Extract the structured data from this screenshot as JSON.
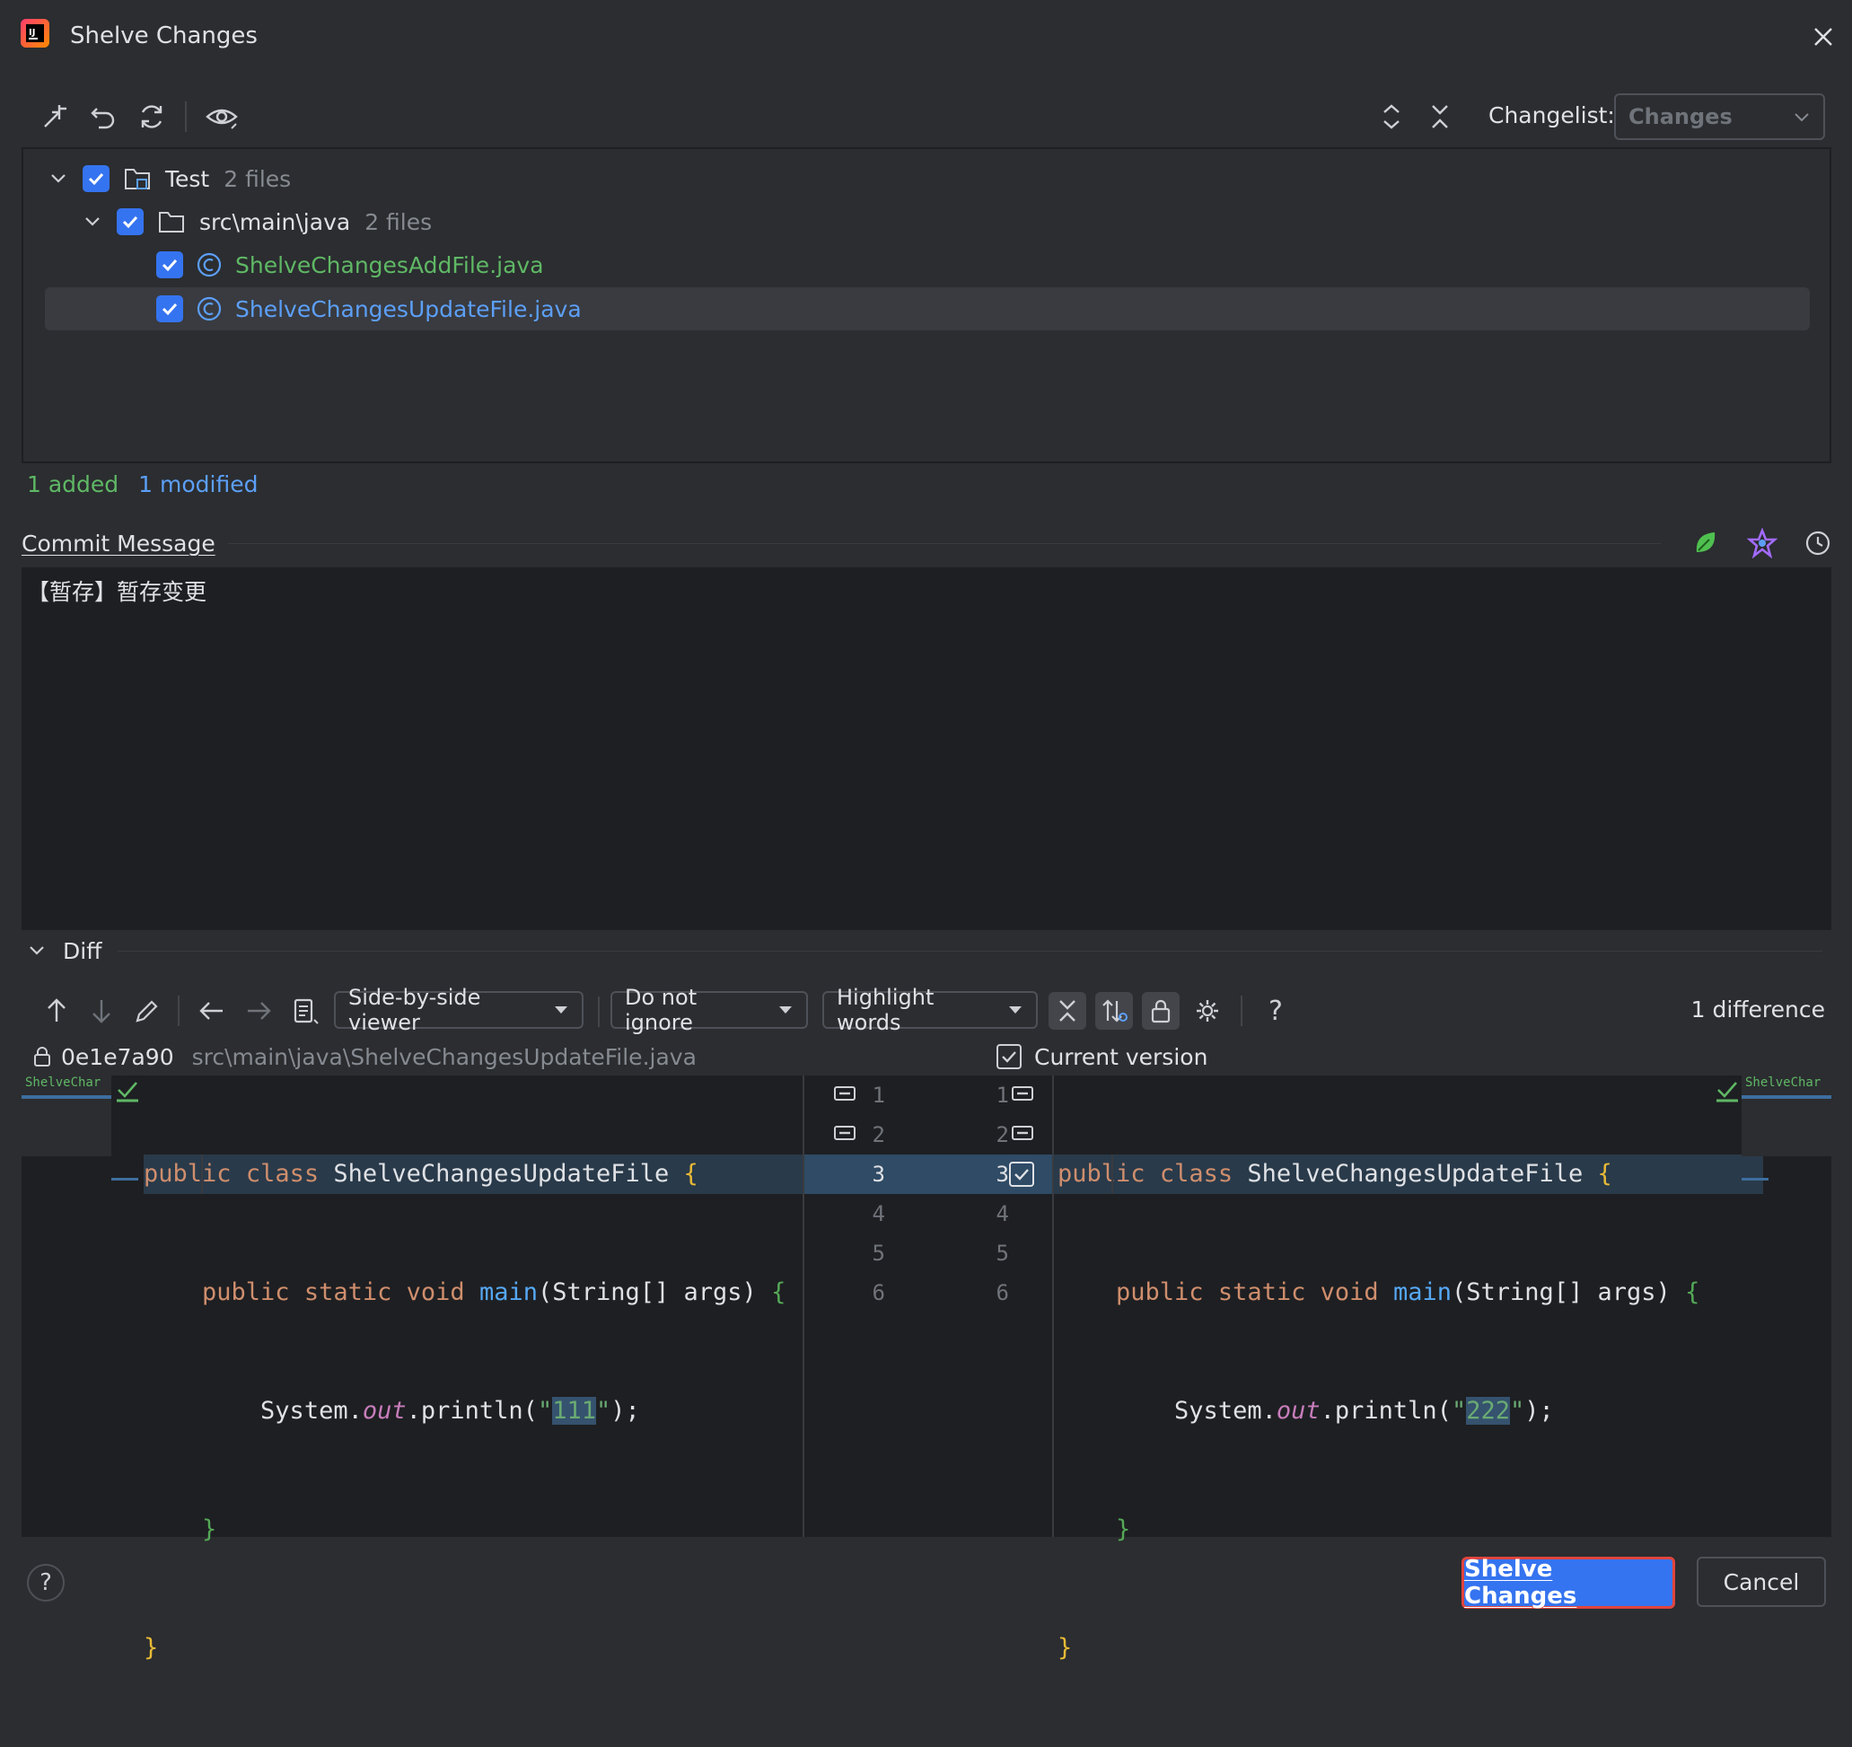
{
  "window": {
    "title": "Shelve Changes"
  },
  "toolbar": {
    "changelist_label": "Changelist:",
    "changelist_value": "Changes"
  },
  "tree": {
    "root": {
      "name": "Test",
      "count": "2 files"
    },
    "folder": {
      "name": "src\\main\\java",
      "count": "2 files"
    },
    "files": [
      {
        "name": "ShelveChangesAddFile.java",
        "status": "added"
      },
      {
        "name": "ShelveChangesUpdateFile.java",
        "status": "modified"
      }
    ]
  },
  "summary": {
    "added": "1 added",
    "modified": "1 modified"
  },
  "commit": {
    "label": "Commit Message",
    "text": "【暂存】暂存变更"
  },
  "diff": {
    "label": "Diff",
    "viewer": "Side-by-side viewer",
    "ignore": "Do not ignore",
    "highlight": "Highlight words",
    "count": "1 difference",
    "left_revision": "0e1e7a90",
    "left_path": "src\\main\\java\\ShelveChangesUpdateFile.java",
    "right_label": "Current version",
    "mini_label": "ShelveChar",
    "left_numbers": [
      "1",
      "2",
      "3",
      "4",
      "5",
      "6"
    ],
    "right_numbers": [
      "1",
      "2",
      "3",
      "4",
      "5",
      "6"
    ],
    "code": {
      "kw_public": "public",
      "kw_class": "class",
      "class_name": "ShelveChangesUpdateFile",
      "kw_static": "static",
      "kw_void": "void",
      "method": "main",
      "params": "(String[] args)",
      "sys": "System.",
      "out": "out",
      "println": ".println(",
      "q": "\"",
      "left_val": "111",
      "right_val": "222",
      "end": ");",
      "open": "{",
      "close": "}"
    }
  },
  "footer": {
    "primary": "Shelve Changes",
    "cancel": "Cancel",
    "help": "?"
  },
  "colors": {
    "accent": "#3574f0",
    "added": "#5fb865",
    "modified": "#5c9ff8",
    "changed_line": "#293a4a"
  }
}
